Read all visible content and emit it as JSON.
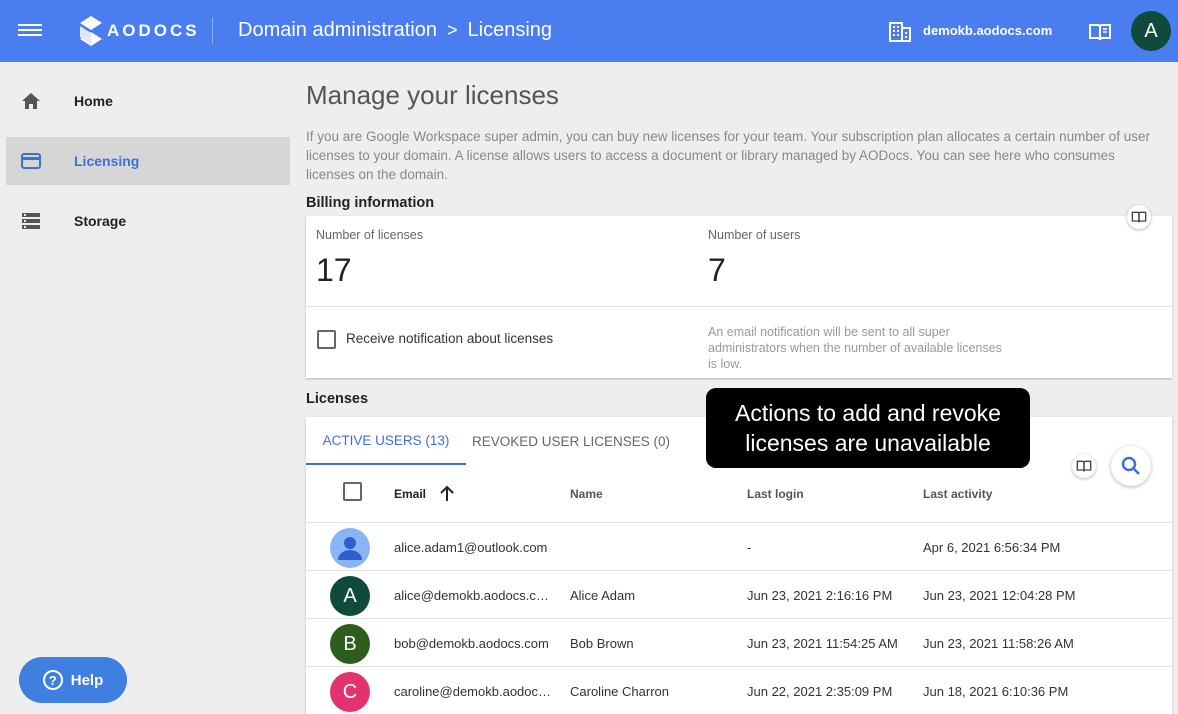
{
  "topbar": {
    "logo_text": "AODOCS",
    "breadcrumb_parent": "Domain administration",
    "breadcrumb_sep": ">",
    "breadcrumb_current": "Licensing",
    "domain": "demokb.aodocs.com",
    "user_initial": "A",
    "accent": "#4a7df0"
  },
  "sidebar": {
    "items": [
      {
        "label": "Home",
        "icon": "home-icon"
      },
      {
        "label": "Licensing",
        "icon": "credit-card-icon",
        "active": true
      },
      {
        "label": "Storage",
        "icon": "storage-icon"
      }
    ],
    "help_label": "Help",
    "help_glyph": "?"
  },
  "main": {
    "title": "Manage your licenses",
    "intro": "If you are Google Workspace super admin, you can buy new licenses for your team. Your subscription plan allocates a certain number of user licenses to your domain. A license allows users to access a document or library managed by AODocs. You can see here who consumes licenses on the domain.",
    "billing": {
      "heading": "Billing information",
      "licenses_label": "Number of licenses",
      "licenses_value": "17",
      "users_label": "Number of users",
      "users_value": "7",
      "notification_label": "Receive notification about licenses",
      "notification_help": "An email notification will be sent to all super administrators when the number of available licenses is low."
    },
    "licenses": {
      "heading": "Licenses",
      "tabs": [
        {
          "label": "ACTIVE USERS (13)",
          "active": true
        },
        {
          "label": "REVOKED USER LICENSES (0)",
          "active": false
        }
      ],
      "columns": {
        "email": "Email",
        "name": "Name",
        "last_login": "Last login",
        "last_activity": "Last activity"
      },
      "rows": [
        {
          "email": "alice.adam1@outlook.com",
          "name": "",
          "last_login": "-",
          "last_activity": "Apr 6, 2021 6:56:34 PM",
          "initial": "",
          "avatar_color": "#8ab4f8",
          "generic": true
        },
        {
          "email": "alice@demokb.aodocs.co…",
          "name": "Alice Adam",
          "last_login": "Jun 23, 2021 2:16:16 PM",
          "last_activity": "Jun 23, 2021 12:04:28 PM",
          "initial": "A",
          "avatar_color": "#0f4a3a"
        },
        {
          "email": "bob@demokb.aodocs.com",
          "name": "Bob Brown",
          "last_login": "Jun 23, 2021 11:54:25 AM",
          "last_activity": "Jun 23, 2021 11:58:26 AM",
          "initial": "B",
          "avatar_color": "#2e5e1e"
        },
        {
          "email": "caroline@demokb.aodocs…",
          "name": "Caroline Charron",
          "last_login": "Jun 22, 2021 2:35:09 PM",
          "last_activity": "Jun 18, 2021 6:10:36 PM",
          "initial": "C",
          "avatar_color": "#e3336f"
        }
      ]
    },
    "tooltip": "Actions to add and revoke licenses are unavailable"
  }
}
